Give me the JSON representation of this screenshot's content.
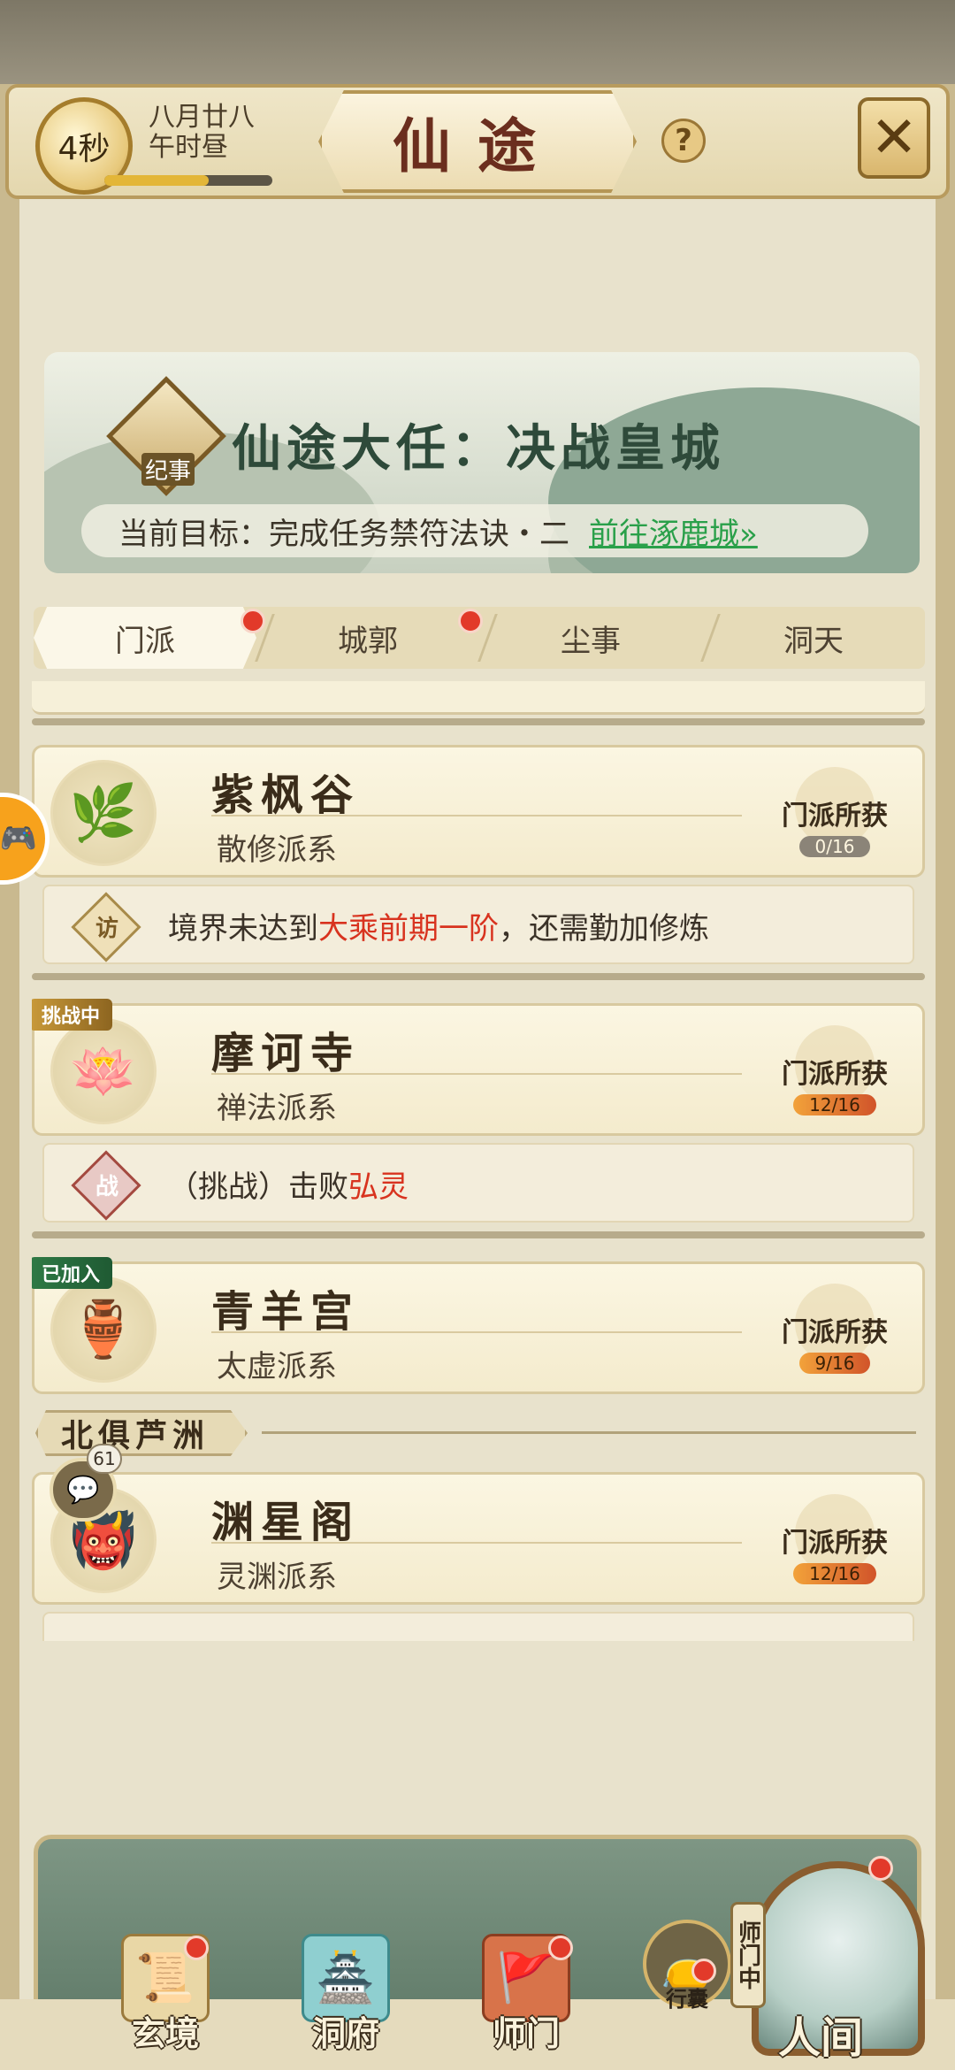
{
  "header": {
    "timer": "4秒",
    "date_line1": "八月廿八",
    "date_line2": "午时昼",
    "title": "仙途",
    "help": "?",
    "close": "✕"
  },
  "quest": {
    "icon_label": "纪事",
    "title": "仙途大任：决战皇城",
    "goal": "当前目标：完成任务禁符法诀・二",
    "goal_link": "前往涿鹿城",
    "goal_link_arrow": "»"
  },
  "tabs": [
    {
      "label": "门派",
      "active": true,
      "dot": true
    },
    {
      "label": "城郭",
      "active": false,
      "dot": true
    },
    {
      "label": "尘事",
      "active": false,
      "dot": false
    },
    {
      "label": "洞天",
      "active": false,
      "dot": false
    }
  ],
  "sects": [
    {
      "name": "紫枫谷",
      "school": "散修派系",
      "gain_label": "门派所获",
      "gain_count": "0/16",
      "emblem": "leaf-fan-icon",
      "info_icon": "访",
      "info_prefix": "境界未达到",
      "info_highlight": "大乘前期一阶",
      "info_suffix": "，还需勤加修炼"
    },
    {
      "name": "摩诃寺",
      "school": "禅法派系",
      "badge": "挑战中",
      "gain_label": "门派所获",
      "gain_count": "12/16",
      "emblem": "lotus-icon",
      "info_icon": "战",
      "info_prefix": "（挑战）击败",
      "info_highlight": "弘灵",
      "info_suffix": ""
    },
    {
      "name": "青羊宫",
      "school": "太虚派系",
      "badge": "已加入",
      "gain_label": "门派所获",
      "gain_count": "9/16",
      "emblem": "cauldron-icon"
    }
  ],
  "region": {
    "name": "北俱芦洲",
    "chat_count": "61"
  },
  "region_sects": [
    {
      "name": "渊星阁",
      "school": "灵渊派系",
      "gain_label": "门派所获",
      "gain_count": "12/16",
      "emblem": "demon-mask-icon"
    }
  ],
  "bottom_nav": {
    "items": [
      {
        "label": "玄境",
        "icon": "scroll-icon",
        "dot": true
      },
      {
        "label": "洞府",
        "icon": "pavilion-icon",
        "dot": false
      },
      {
        "label": "师门",
        "icon": "banner-icon",
        "dot": true
      }
    ],
    "bag_label": "行囊",
    "master_tag": "师门中",
    "world_label": "人间"
  },
  "colors": {
    "accent_red": "#d8331f",
    "link_green": "#2aa04a",
    "dot_red": "#e23a2a"
  }
}
